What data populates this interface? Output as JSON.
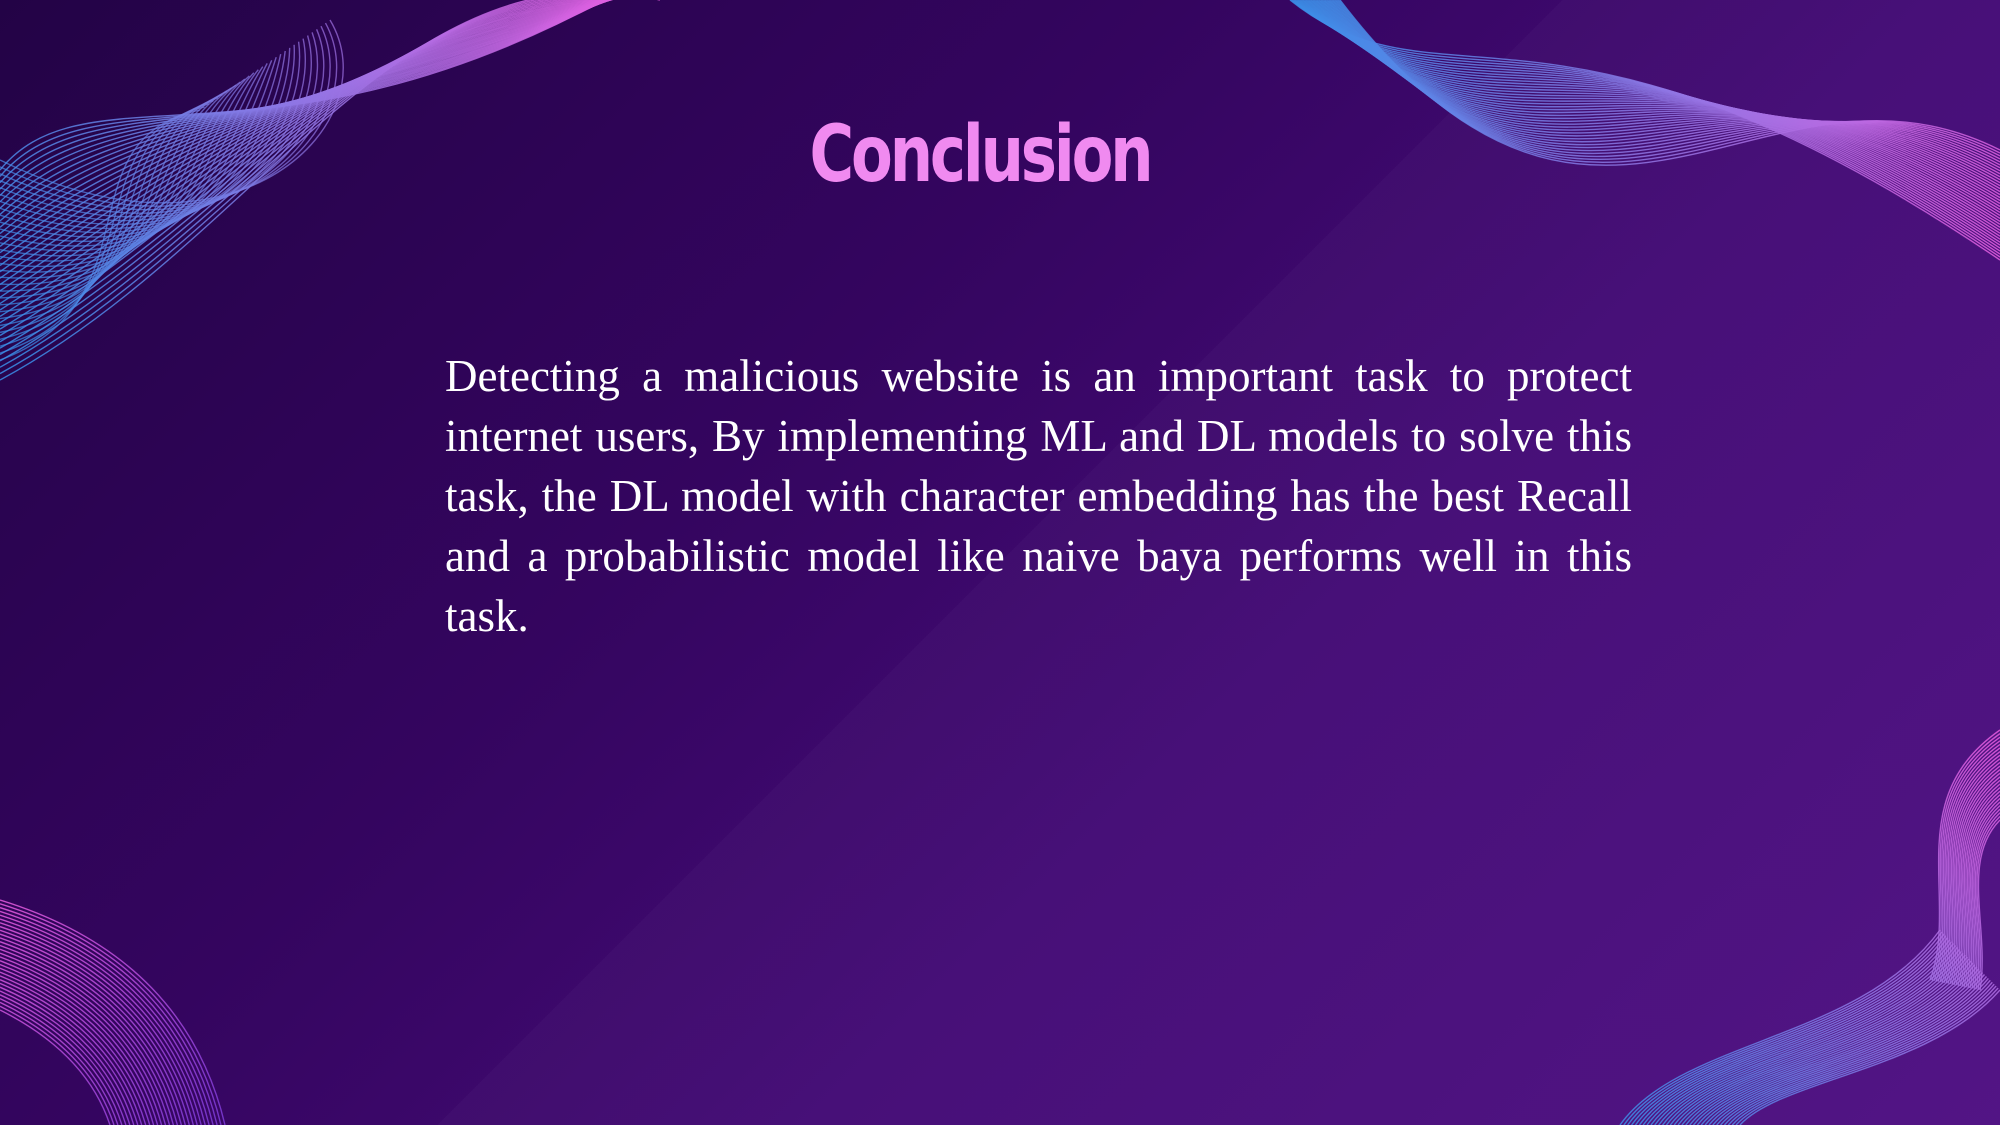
{
  "slide": {
    "title": "Conclusion",
    "body": "Detecting a malicious website is an important task to protect internet users, By implementing ML and DL models to solve this task, the DL model with character embedding has the best Recall and a probabilistic model like naive baya performs well in this task."
  },
  "colors": {
    "background_dark": "#230346",
    "background_light": "#4e0f82",
    "title": "#f08af0",
    "body_text": "#ffffff",
    "wave_blue": "#3a8ee8",
    "wave_pink": "#e85ce0"
  }
}
